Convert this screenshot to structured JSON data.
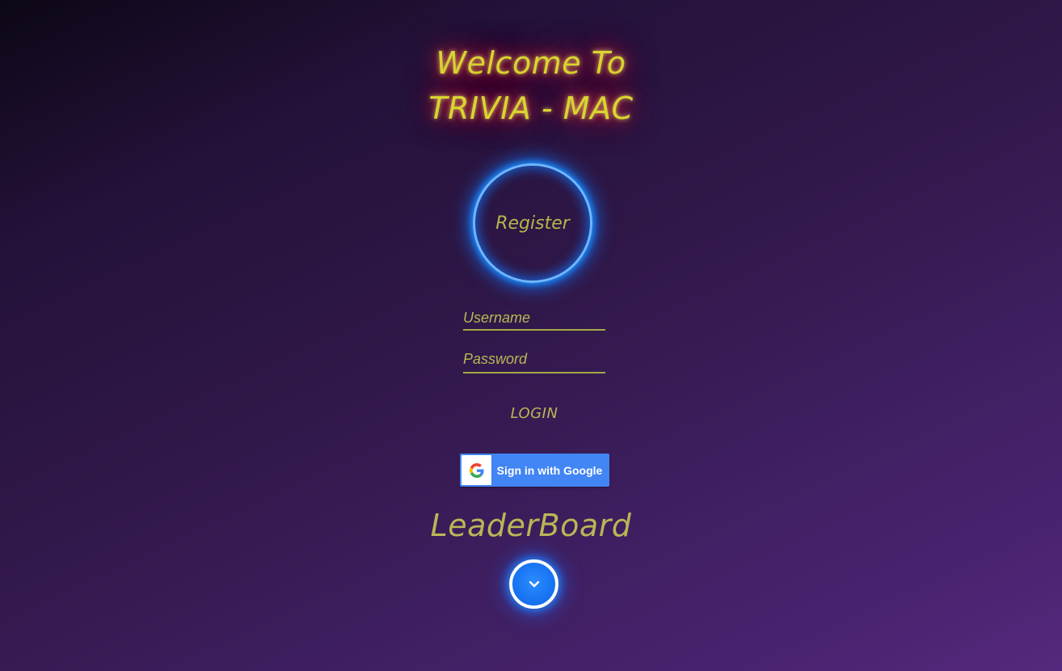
{
  "header": {
    "title_line1": "Welcome To",
    "title_line2": "TRIVIA - MAC"
  },
  "register": {
    "label": "Register"
  },
  "login_form": {
    "username_placeholder": "Username",
    "username_value": "",
    "password_placeholder": "Password",
    "password_value": "",
    "login_label": "LOGIN"
  },
  "google_signin": {
    "label": "Sign in with Google",
    "icon": "google-g-icon"
  },
  "leaderboard": {
    "title": "LeaderBoard",
    "expand_icon": "chevron-down-icon"
  },
  "colors": {
    "neon_yellow": "#d8d630",
    "neon_red_glow": "#c81432",
    "neon_blue": "#1b8dff",
    "google_blue": "#4285f4",
    "background_dark": "#0d0716",
    "background_purple": "#55287e"
  }
}
